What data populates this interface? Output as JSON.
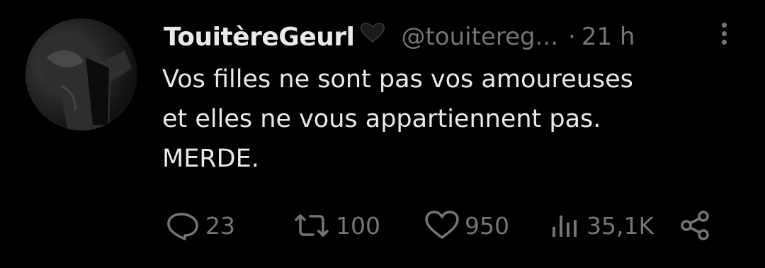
{
  "tweet": {
    "display_name": "TouitèreGeurl",
    "handle": "@touitereg...",
    "separator": "·",
    "time": "21 h",
    "text_lines": [
      "Vos filles ne sont pas vos amoureuses",
      "et elles ne vous appartiennent pas.",
      "MERDE."
    ],
    "actions": {
      "replies": "23",
      "retweets": "100",
      "likes": "950",
      "views": "35,1K"
    }
  },
  "colors": {
    "background": "#000000",
    "primary_text": "#e7e9ea",
    "secondary_text": "#71767b"
  },
  "icons": [
    "avatar",
    "heart-badge-icon",
    "more-options-icon",
    "reply-icon",
    "retweet-icon",
    "like-icon",
    "views-icon",
    "share-icon"
  ]
}
